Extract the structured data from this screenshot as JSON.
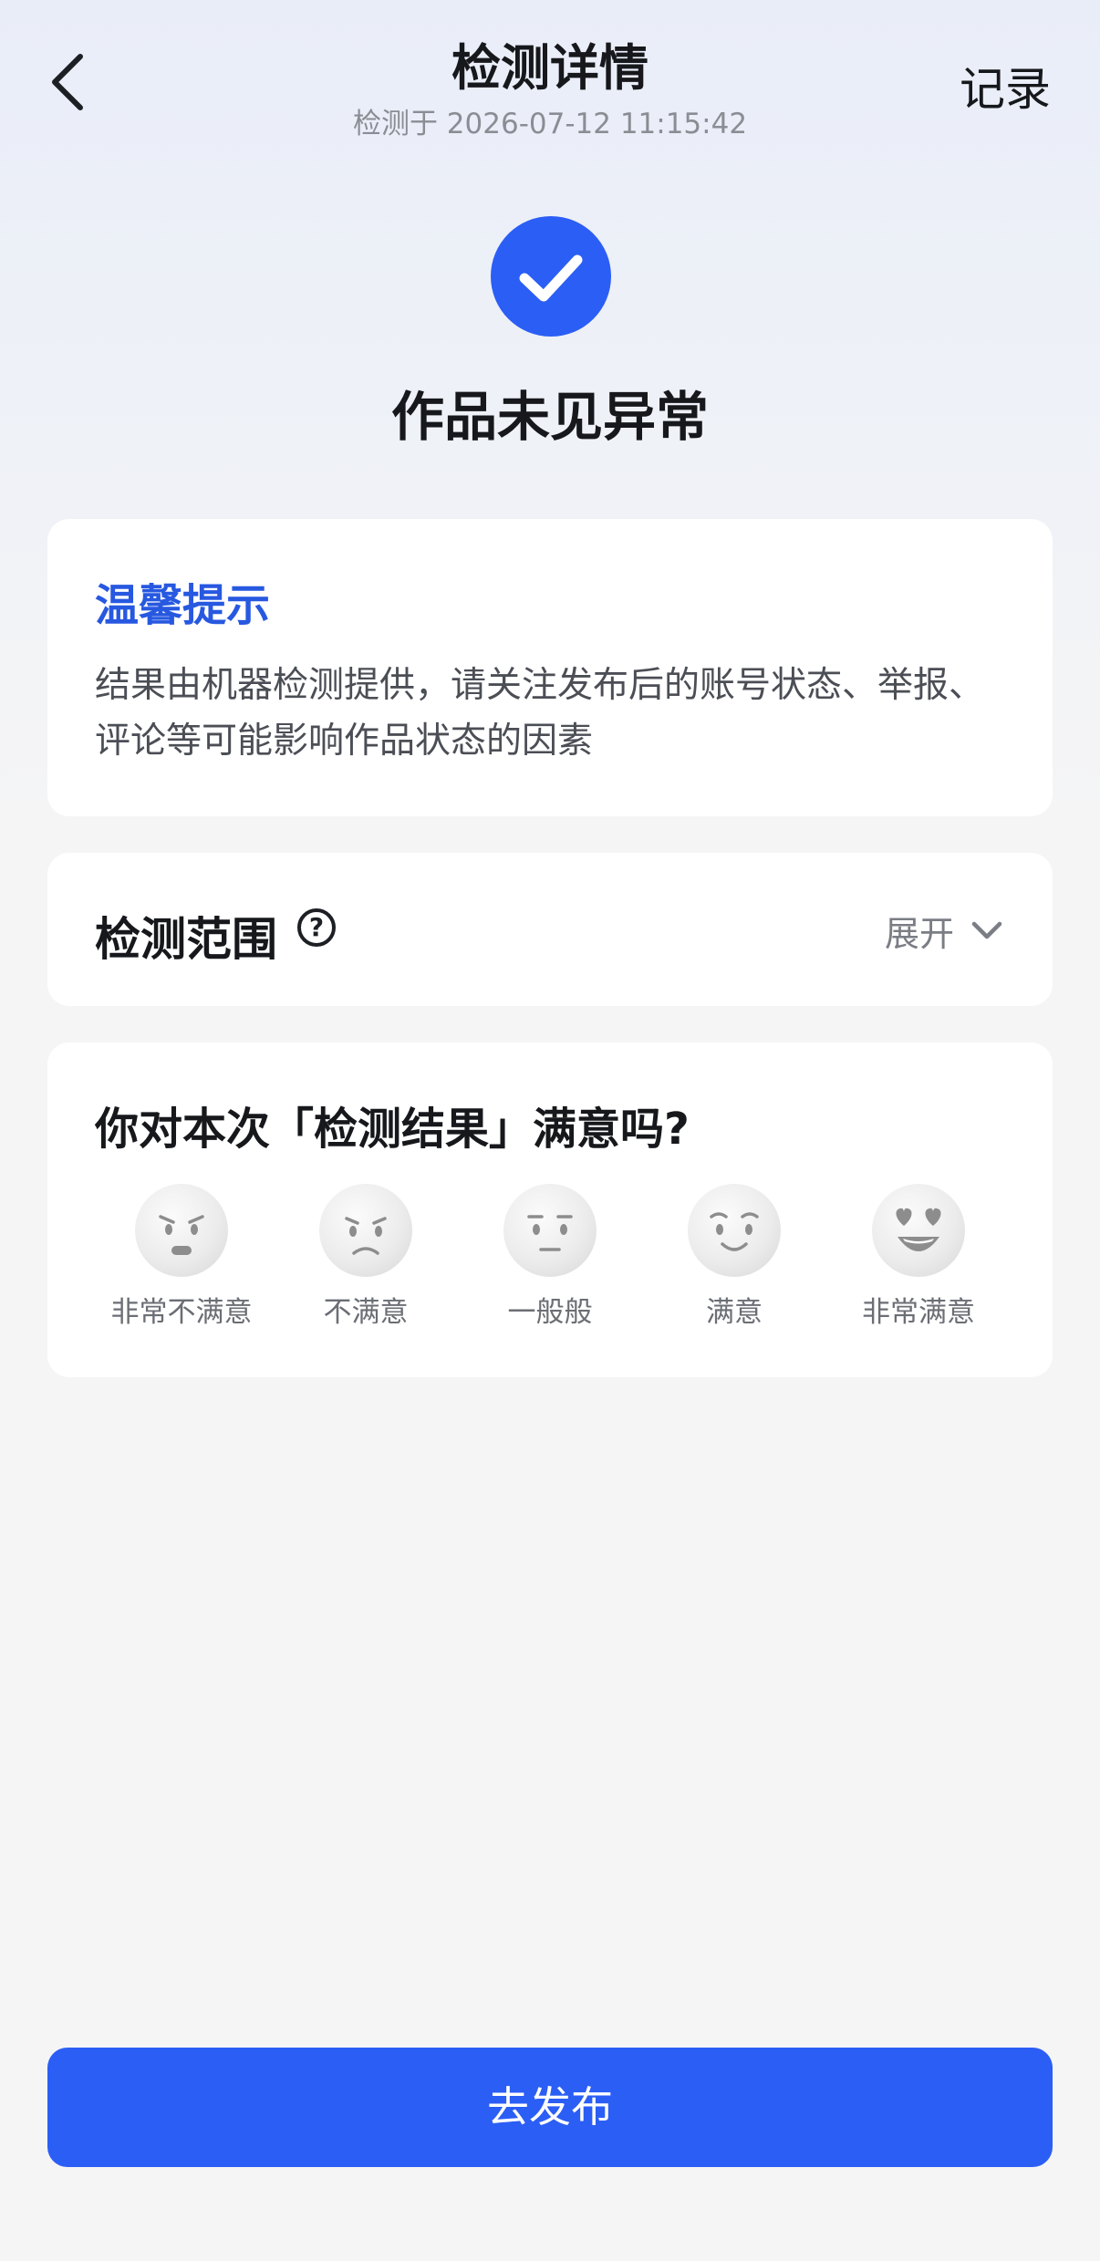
{
  "header": {
    "title": "检测详情",
    "subtitle": "检测于 2026-07-12 11:15:42",
    "records_label": "记录"
  },
  "status": {
    "text": "作品未见异常",
    "icon": "check-circle-icon",
    "color": "#2b5ef5"
  },
  "tip": {
    "title": "温馨提示",
    "body": "结果由机器检测提供，请关注发布后的账号状态、举报、评论等可能影响作品状态的因素",
    "title_color": "#2758e0"
  },
  "scope": {
    "title": "检测范围",
    "expand_label": "展开"
  },
  "survey": {
    "question": "你对本次「检测结果」满意吗?",
    "options": [
      {
        "label": "非常不满意",
        "icon": "very-dissatisfied-face-icon"
      },
      {
        "label": "不满意",
        "icon": "dissatisfied-face-icon"
      },
      {
        "label": "一般般",
        "icon": "neutral-face-icon"
      },
      {
        "label": "满意",
        "icon": "satisfied-face-icon"
      },
      {
        "label": "非常满意",
        "icon": "very-satisfied-face-icon"
      }
    ]
  },
  "publish_button": {
    "label": "去发布",
    "color": "#2b5ef5"
  }
}
